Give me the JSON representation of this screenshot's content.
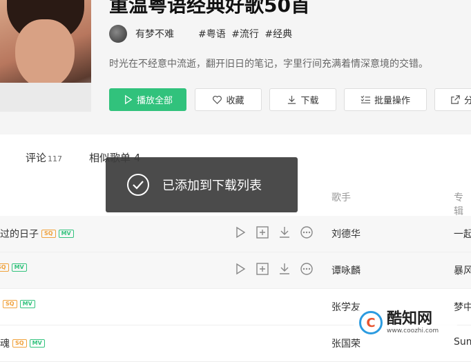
{
  "playlist": {
    "title": "重温粤语经典好歌50首",
    "author": "有梦不难",
    "tags": [
      "#粤语",
      "#流行",
      "#经典"
    ],
    "description": "时光在不经意中流逝，翻开旧日的笔记，字里行间充满着情深意境的交错。"
  },
  "actions": {
    "play_all": "播放全部",
    "favorite": "收藏",
    "download": "下载",
    "batch": "批量操作",
    "share": "分"
  },
  "tabs": {
    "comments_label": "评论",
    "comments_count": "117",
    "similar_label": "相似歌单",
    "similar_count": "4"
  },
  "columns": {
    "singer": "歌手",
    "album": "专辑"
  },
  "songs": [
    {
      "name": "过的日子",
      "badges": [
        "SQ",
        "MV"
      ],
      "singer": "刘德华",
      "album": "一起"
    },
    {
      "name": "",
      "badges": [
        "SQ",
        "MV"
      ],
      "singer": "谭咏麟",
      "album": "暴风"
    },
    {
      "name": "",
      "badges": [
        "SQ",
        "MV"
      ],
      "singer": "张学友",
      "album": "梦中"
    },
    {
      "name": "魂",
      "badges": [
        "SQ",
        "MV"
      ],
      "singer": "张国荣",
      "album": "Sum"
    }
  ],
  "toast": {
    "message": "已添加到下载列表"
  },
  "watermark": {
    "name": "酷知网",
    "url": "www.coozhi.com"
  },
  "colors": {
    "accent": "#31c27c",
    "toast_bg": "#3c3c3c"
  }
}
